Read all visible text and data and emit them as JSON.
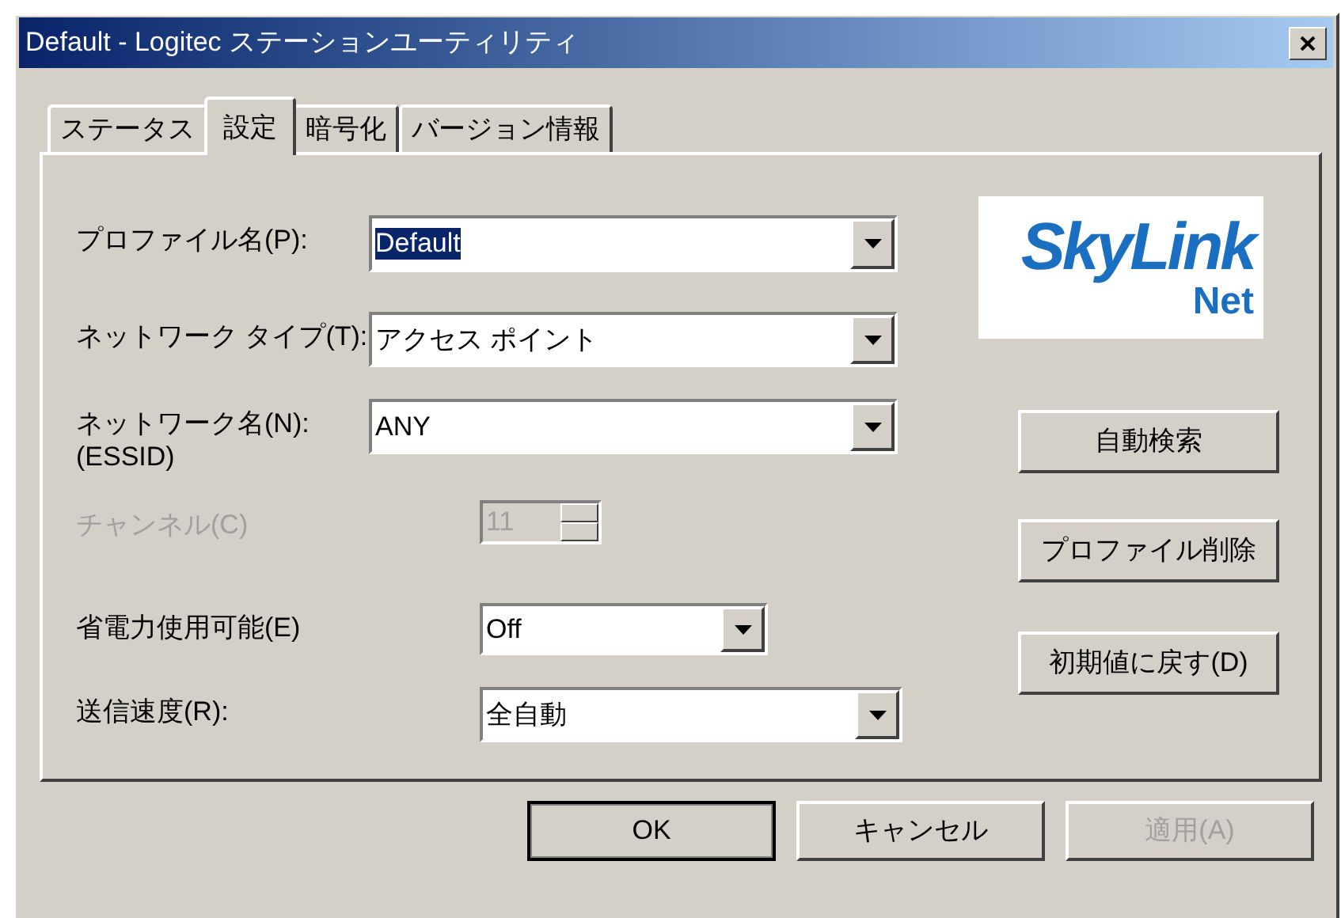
{
  "window": {
    "title": "Default - Logitec ステーションユーティリティ"
  },
  "tabs": [
    {
      "label": "ステータス",
      "selected": false
    },
    {
      "label": "設定",
      "selected": true
    },
    {
      "label": "暗号化",
      "selected": false
    },
    {
      "label": "バージョン情報",
      "selected": false
    }
  ],
  "fields": [
    {
      "kind": "combo",
      "label": "プロファイル名(P):",
      "value": "Default",
      "value_highlighted": true,
      "disabled": false
    },
    {
      "kind": "combo",
      "label": "ネットワーク タイプ(T):",
      "value": "アクセス ポイント",
      "value_highlighted": false,
      "disabled": false
    },
    {
      "kind": "combo",
      "label": "ネットワーク名(N):",
      "sublabel": "(ESSID)",
      "value": "ANY",
      "value_highlighted": false,
      "disabled": false
    },
    {
      "kind": "spinner",
      "label": "チャンネル(C)",
      "value": "11",
      "value_highlighted": false,
      "disabled": true
    },
    {
      "kind": "combo",
      "label": "省電力使用可能(E)",
      "value": "Off",
      "value_highlighted": false,
      "disabled": false
    },
    {
      "kind": "combo",
      "label": "送信速度(R):",
      "value": "全自動",
      "value_highlighted": false,
      "disabled": false
    }
  ],
  "logo": {
    "top": "SkyLink",
    "bottom": "Net"
  },
  "side_buttons": [
    {
      "label": "自動検索"
    },
    {
      "label": "プロファイル削除"
    },
    {
      "label": "初期値に戻す(D)"
    }
  ],
  "dialog_buttons": [
    {
      "label": "OK",
      "default": true,
      "disabled": false
    },
    {
      "label": "キャンセル",
      "default": false,
      "disabled": false
    },
    {
      "label": "適用(A)",
      "default": false,
      "disabled": true
    }
  ]
}
